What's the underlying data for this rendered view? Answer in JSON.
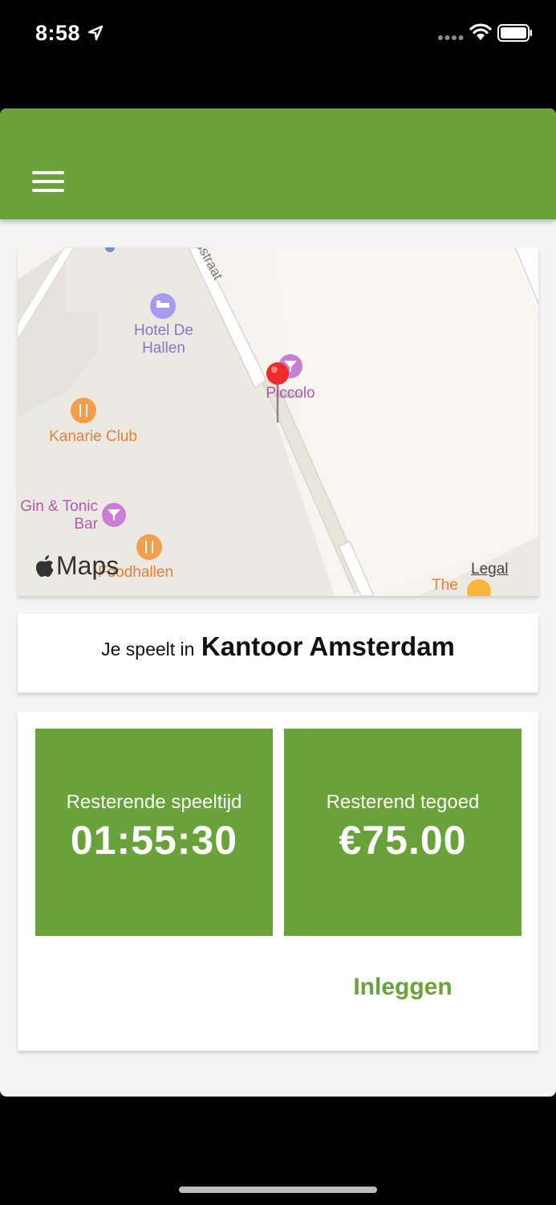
{
  "status_bar": {
    "time": "8:58"
  },
  "header": {
    "menu_icon": "hamburger-menu-icon",
    "color": "#6aa23a"
  },
  "map": {
    "labels": {
      "hotel": "Hotel De Hallen",
      "piccolo": "Piccolo",
      "kanarie": "Kanarie Club",
      "gin": "Gin & Tonic Bar",
      "foodhallen": "Foodhallen",
      "the": "The",
      "street": "sstraat"
    },
    "maps_brand": "Maps",
    "legal": "Legal"
  },
  "location": {
    "prefix": "Je speelt in",
    "name": "Kantoor Amsterdam"
  },
  "stats": {
    "time_label": "Resterende speeltijd",
    "time_value": "01:55:30",
    "credit_label": "Resterend tegoed",
    "credit_value": "€75.00"
  },
  "actions": {
    "deposit_label": "Inleggen"
  }
}
